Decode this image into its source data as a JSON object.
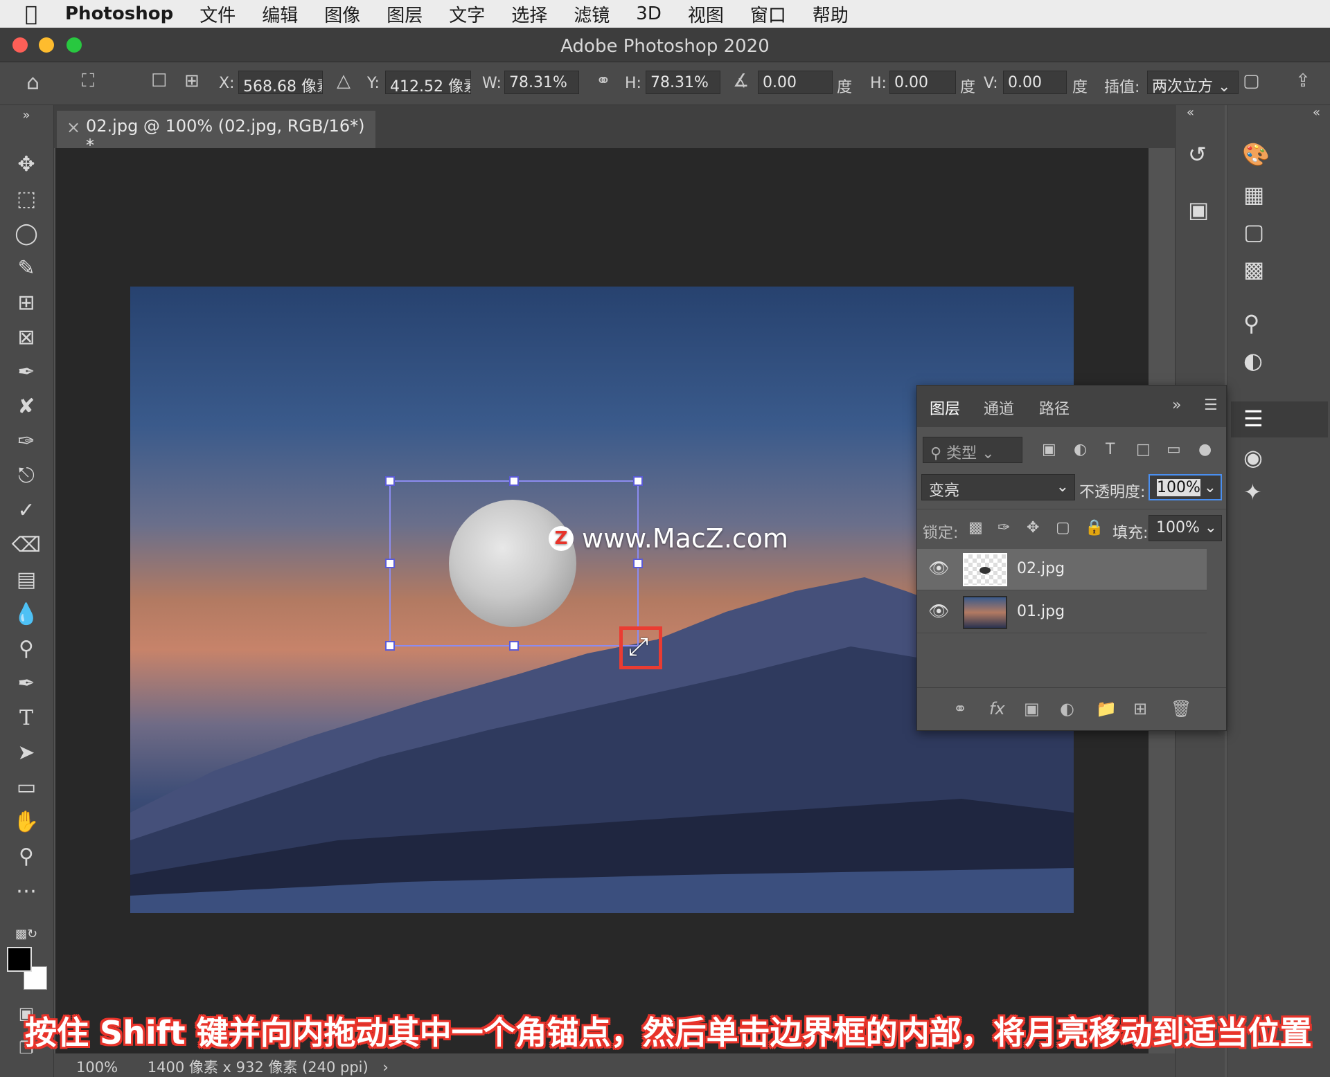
{
  "menubar": {
    "app": "Photoshop",
    "items": [
      "文件",
      "编辑",
      "图像",
      "图层",
      "文字",
      "选择",
      "滤镜",
      "3D",
      "视图",
      "窗口",
      "帮助"
    ]
  },
  "window": {
    "title": "Adobe Photoshop 2020"
  },
  "options": {
    "x_label": "X:",
    "x_value": "568.68 像素",
    "y_label": "Y:",
    "y_value": "412.52 像素",
    "w_label": "W:",
    "w_value": "78.31%",
    "h_label": "H:",
    "h_value": "78.31%",
    "angle_value": "0.00",
    "angle_unit": "度",
    "hskew_label": "H:",
    "hskew_value": "0.00",
    "hskew_unit": "度",
    "vskew_label": "V:",
    "vskew_value": "0.00",
    "vskew_unit": "度",
    "interp_label": "插值:",
    "interp_value": "两次立方"
  },
  "document": {
    "tab_title": "02.jpg @ 100% (02.jpg, RGB/16*) *"
  },
  "watermark": {
    "badge": "Z",
    "text": "www.MacZ.com"
  },
  "layers_panel": {
    "tabs": [
      "图层",
      "通道",
      "路径"
    ],
    "filter_placeholder": "类型",
    "blend_mode": "变亮",
    "opacity_label": "不透明度:",
    "opacity_value": "100%",
    "lock_label": "锁定:",
    "fill_label": "填充:",
    "fill_value": "100%",
    "layers": [
      {
        "name": "02.jpg",
        "selected": true
      },
      {
        "name": "01.jpg",
        "selected": false
      }
    ]
  },
  "status": {
    "zoom": "100%",
    "info": "1400 像素 x 932 像素 (240 ppi)"
  },
  "caption": "按住 Shift 键并向内拖动其中一个角锚点，然后单击边界框的内部，将月亮移动到适当位置"
}
